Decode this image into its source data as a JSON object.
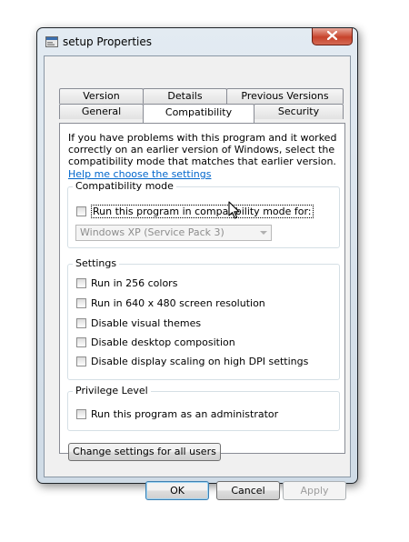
{
  "window": {
    "title": "setup Properties"
  },
  "tabs": {
    "back_row": [
      "Version",
      "Details",
      "Previous Versions"
    ],
    "front_row": [
      "General",
      "Compatibility",
      "Security"
    ],
    "active": "Compatibility"
  },
  "compat": {
    "intro": "If you have problems with this program and it worked correctly on an earlier version of Windows, select the compatibility mode that matches that earlier version.",
    "help_link": "Help me choose the settings",
    "mode_group": {
      "title": "Compatibility mode",
      "checkbox_label": "Run this program in compatibility mode for:",
      "checked": false,
      "dropdown_value": "Windows XP (Service Pack 3)"
    },
    "settings_group": {
      "title": "Settings",
      "options": [
        {
          "label": "Run in 256 colors",
          "checked": false
        },
        {
          "label": "Run in 640 x 480 screen resolution",
          "checked": false
        },
        {
          "label": "Disable visual themes",
          "checked": false
        },
        {
          "label": "Disable desktop composition",
          "checked": false
        },
        {
          "label": "Disable display scaling on high DPI settings",
          "checked": false
        }
      ]
    },
    "privilege_group": {
      "title": "Privilege Level",
      "checkbox_label": "Run this program as an administrator",
      "checked": false
    },
    "all_users_button": "Change settings for all users"
  },
  "buttons": {
    "ok": "OK",
    "cancel": "Cancel",
    "apply": "Apply"
  },
  "icons": {
    "close": "close-icon",
    "app": "setup-app-icon",
    "cursor": "mouse-pointer-icon"
  },
  "colors": {
    "link": "#0066cc",
    "close_button": "#c7432b",
    "panel": "#ffffff"
  }
}
